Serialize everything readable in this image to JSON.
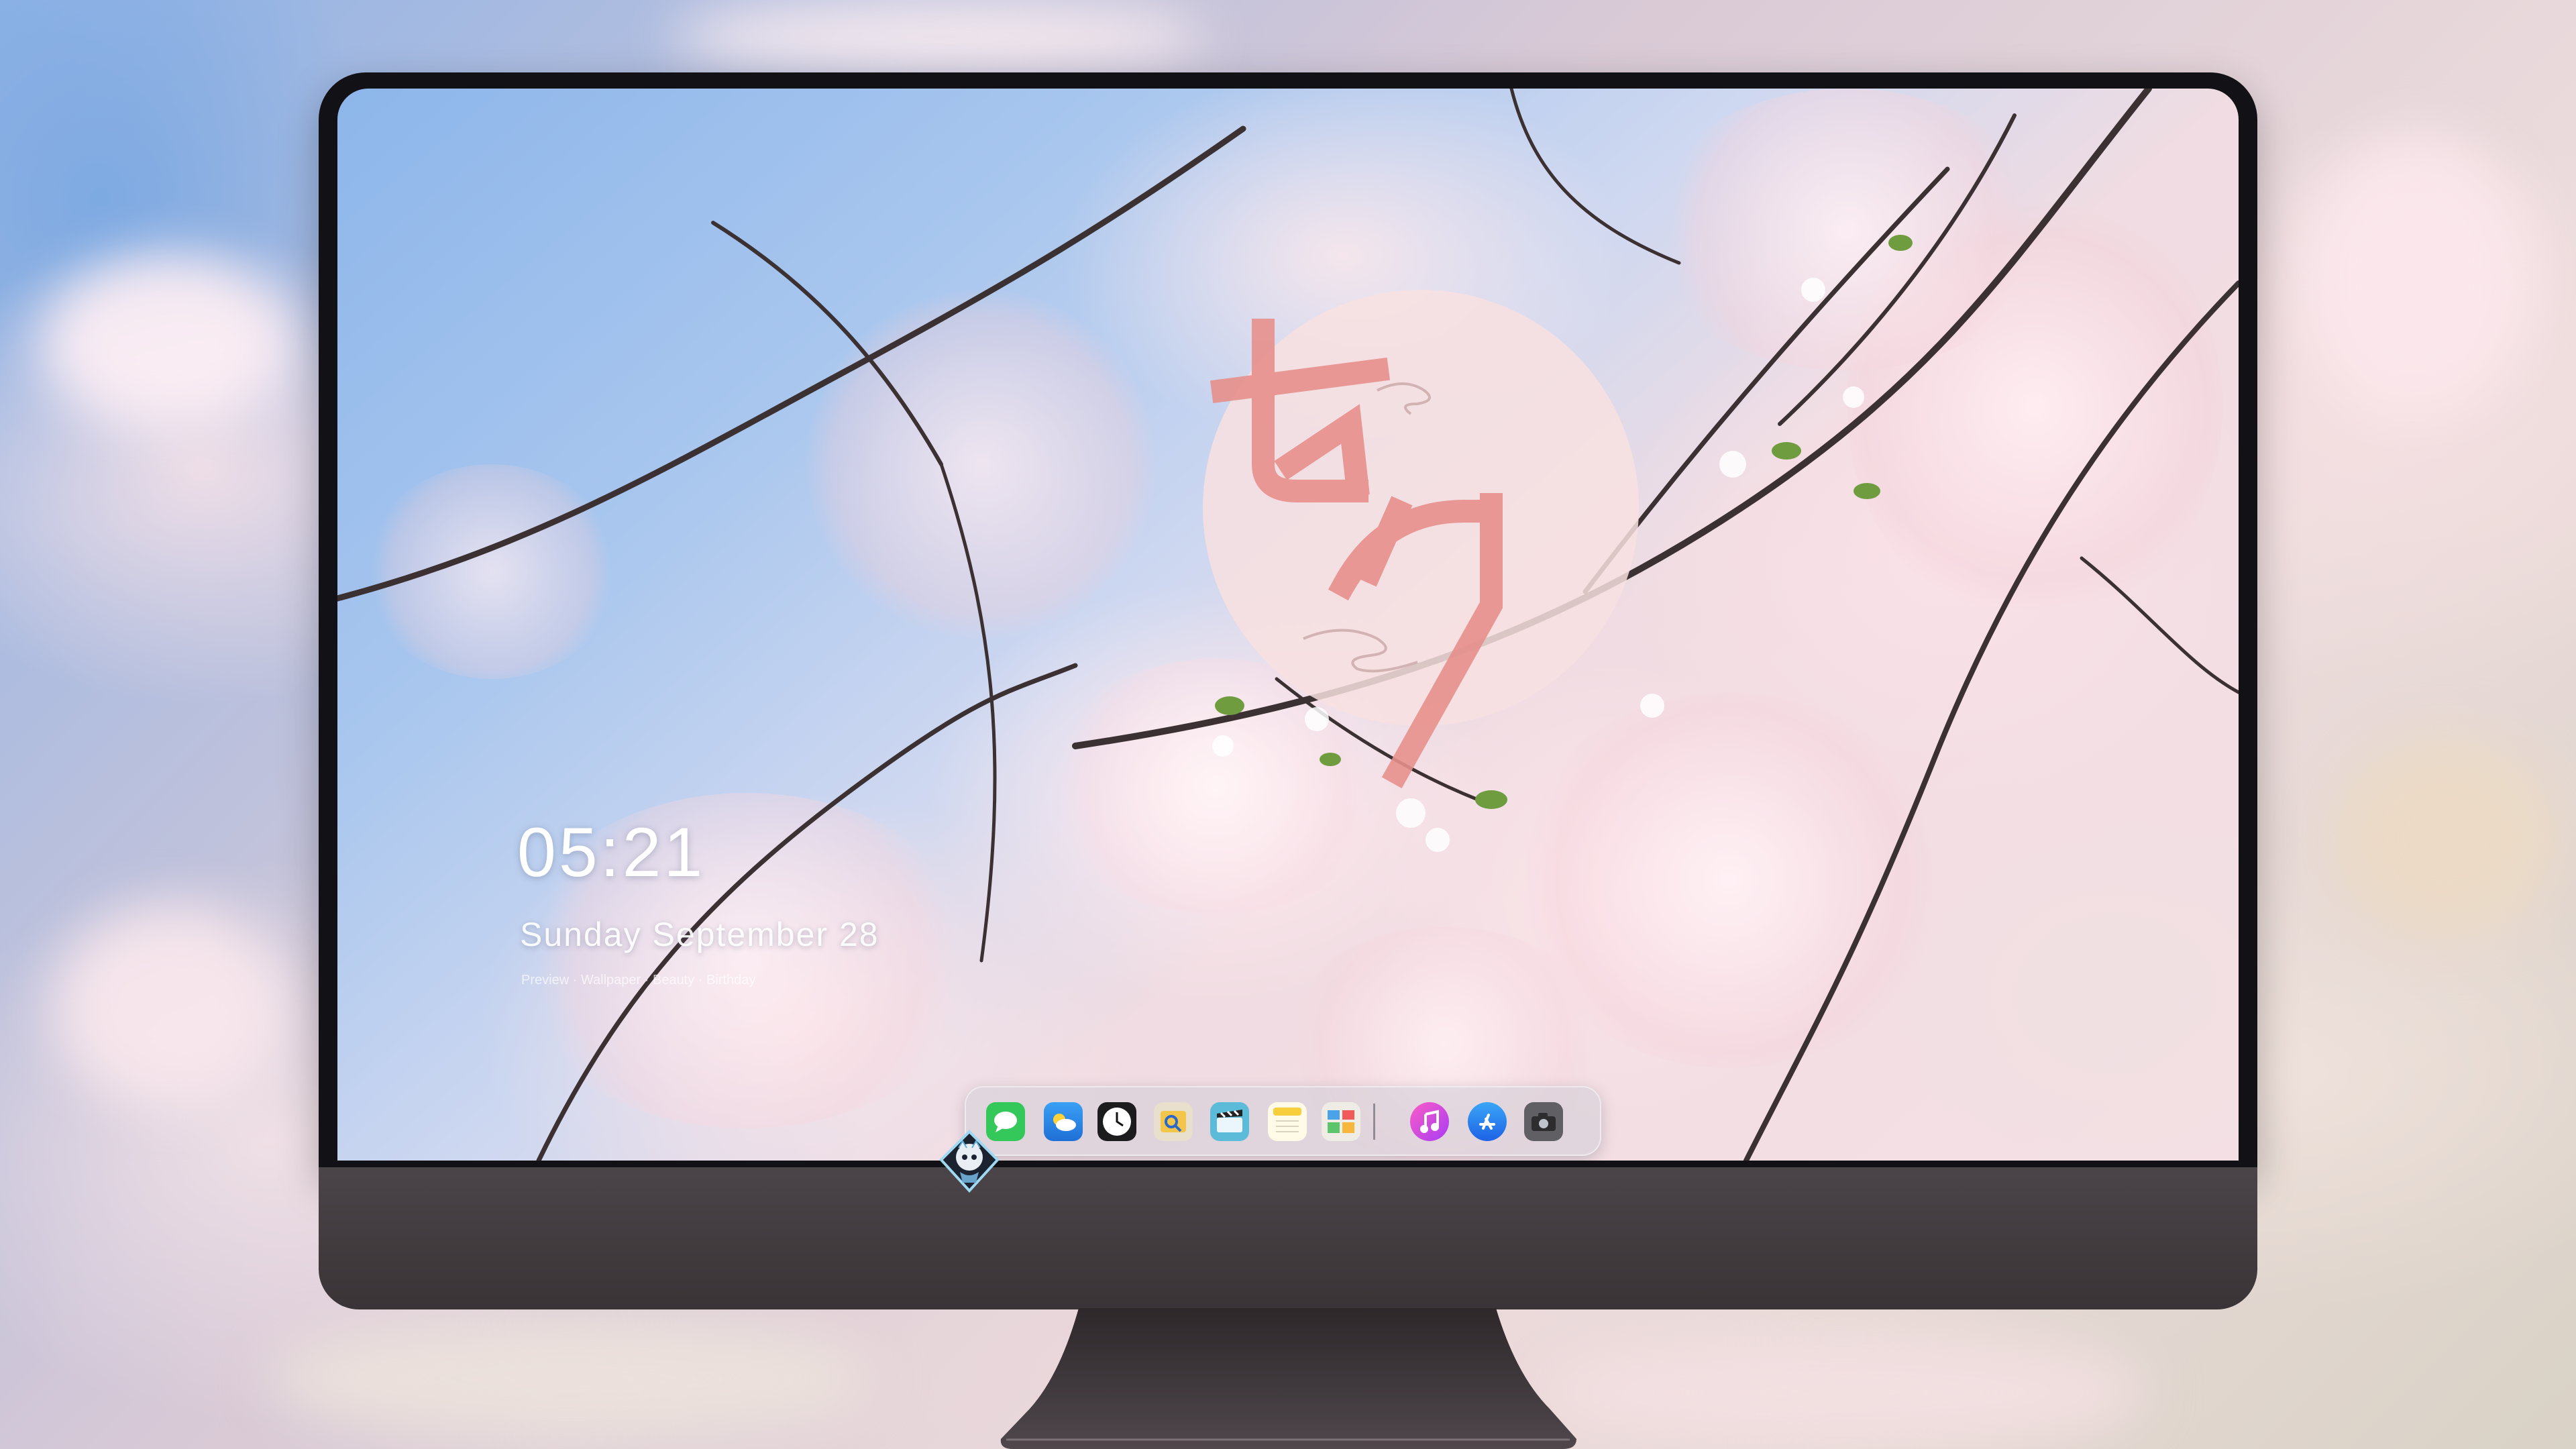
{
  "desktop": {
    "clock": "05:21",
    "date": "Sunday September  28",
    "subline": "Preview · Wallpaper · Beauty · Birthday"
  },
  "dock": {
    "apps": [
      {
        "name": "messages-icon",
        "color": "#34c759"
      },
      {
        "name": "weather-icon",
        "color": "#3a9bf0"
      },
      {
        "name": "clock-icon",
        "color": "#1c1c1e"
      },
      {
        "name": "preview-icon",
        "color": "#f0c34a"
      },
      {
        "name": "claquette-icon",
        "color": "#57b9d8"
      },
      {
        "name": "notes-icon",
        "color": "#f7d24a"
      },
      {
        "name": "photo-board-icon",
        "color": "#e8e4de"
      },
      {
        "name": "music-icon",
        "color": "#e044c8"
      },
      {
        "name": "app-store-icon",
        "color": "#2f7cf6"
      },
      {
        "name": "camera-icon",
        "color": "#6c6c70"
      }
    ]
  },
  "colors": {
    "bezel": "#121216",
    "chin": "#433c40",
    "accent_pink": "#e7908c"
  }
}
